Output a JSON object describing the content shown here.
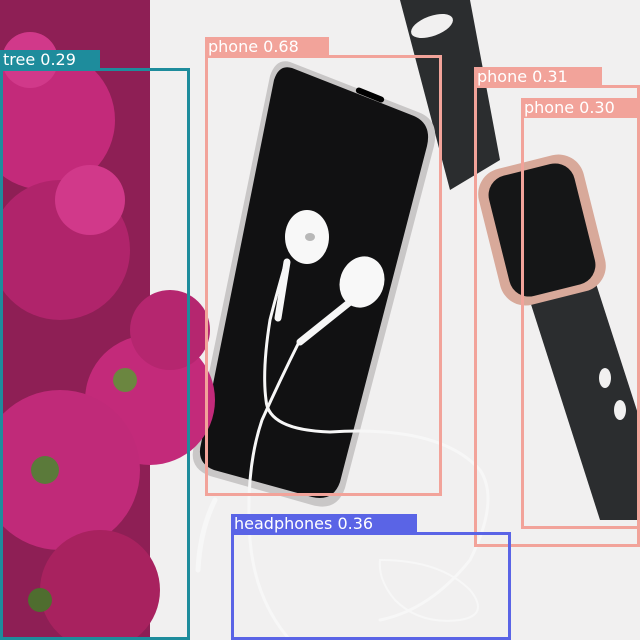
{
  "image": {
    "description_icons": [
      "flower-bouquet",
      "smartphone",
      "smartwatch",
      "wired-earbuds"
    ]
  },
  "detections": [
    {
      "id": "tree",
      "label": "tree 0.29",
      "class": "tree",
      "confidence": 0.29,
      "color": "#1e8c9c"
    },
    {
      "id": "phone-main",
      "label": "phone 0.68",
      "class": "phone",
      "confidence": 0.68,
      "color": "#f2a39a"
    },
    {
      "id": "phone-watch",
      "label": "phone 0.31",
      "class": "phone",
      "confidence": 0.31,
      "color": "#f2a39a"
    },
    {
      "id": "phone-strap",
      "label": "phone 0.30",
      "class": "phone",
      "confidence": 0.3,
      "color": "#f2a39a"
    },
    {
      "id": "headphones",
      "label": "headphones 0.36",
      "class": "headphones",
      "confidence": 0.36,
      "color": "#5a64e6"
    }
  ]
}
